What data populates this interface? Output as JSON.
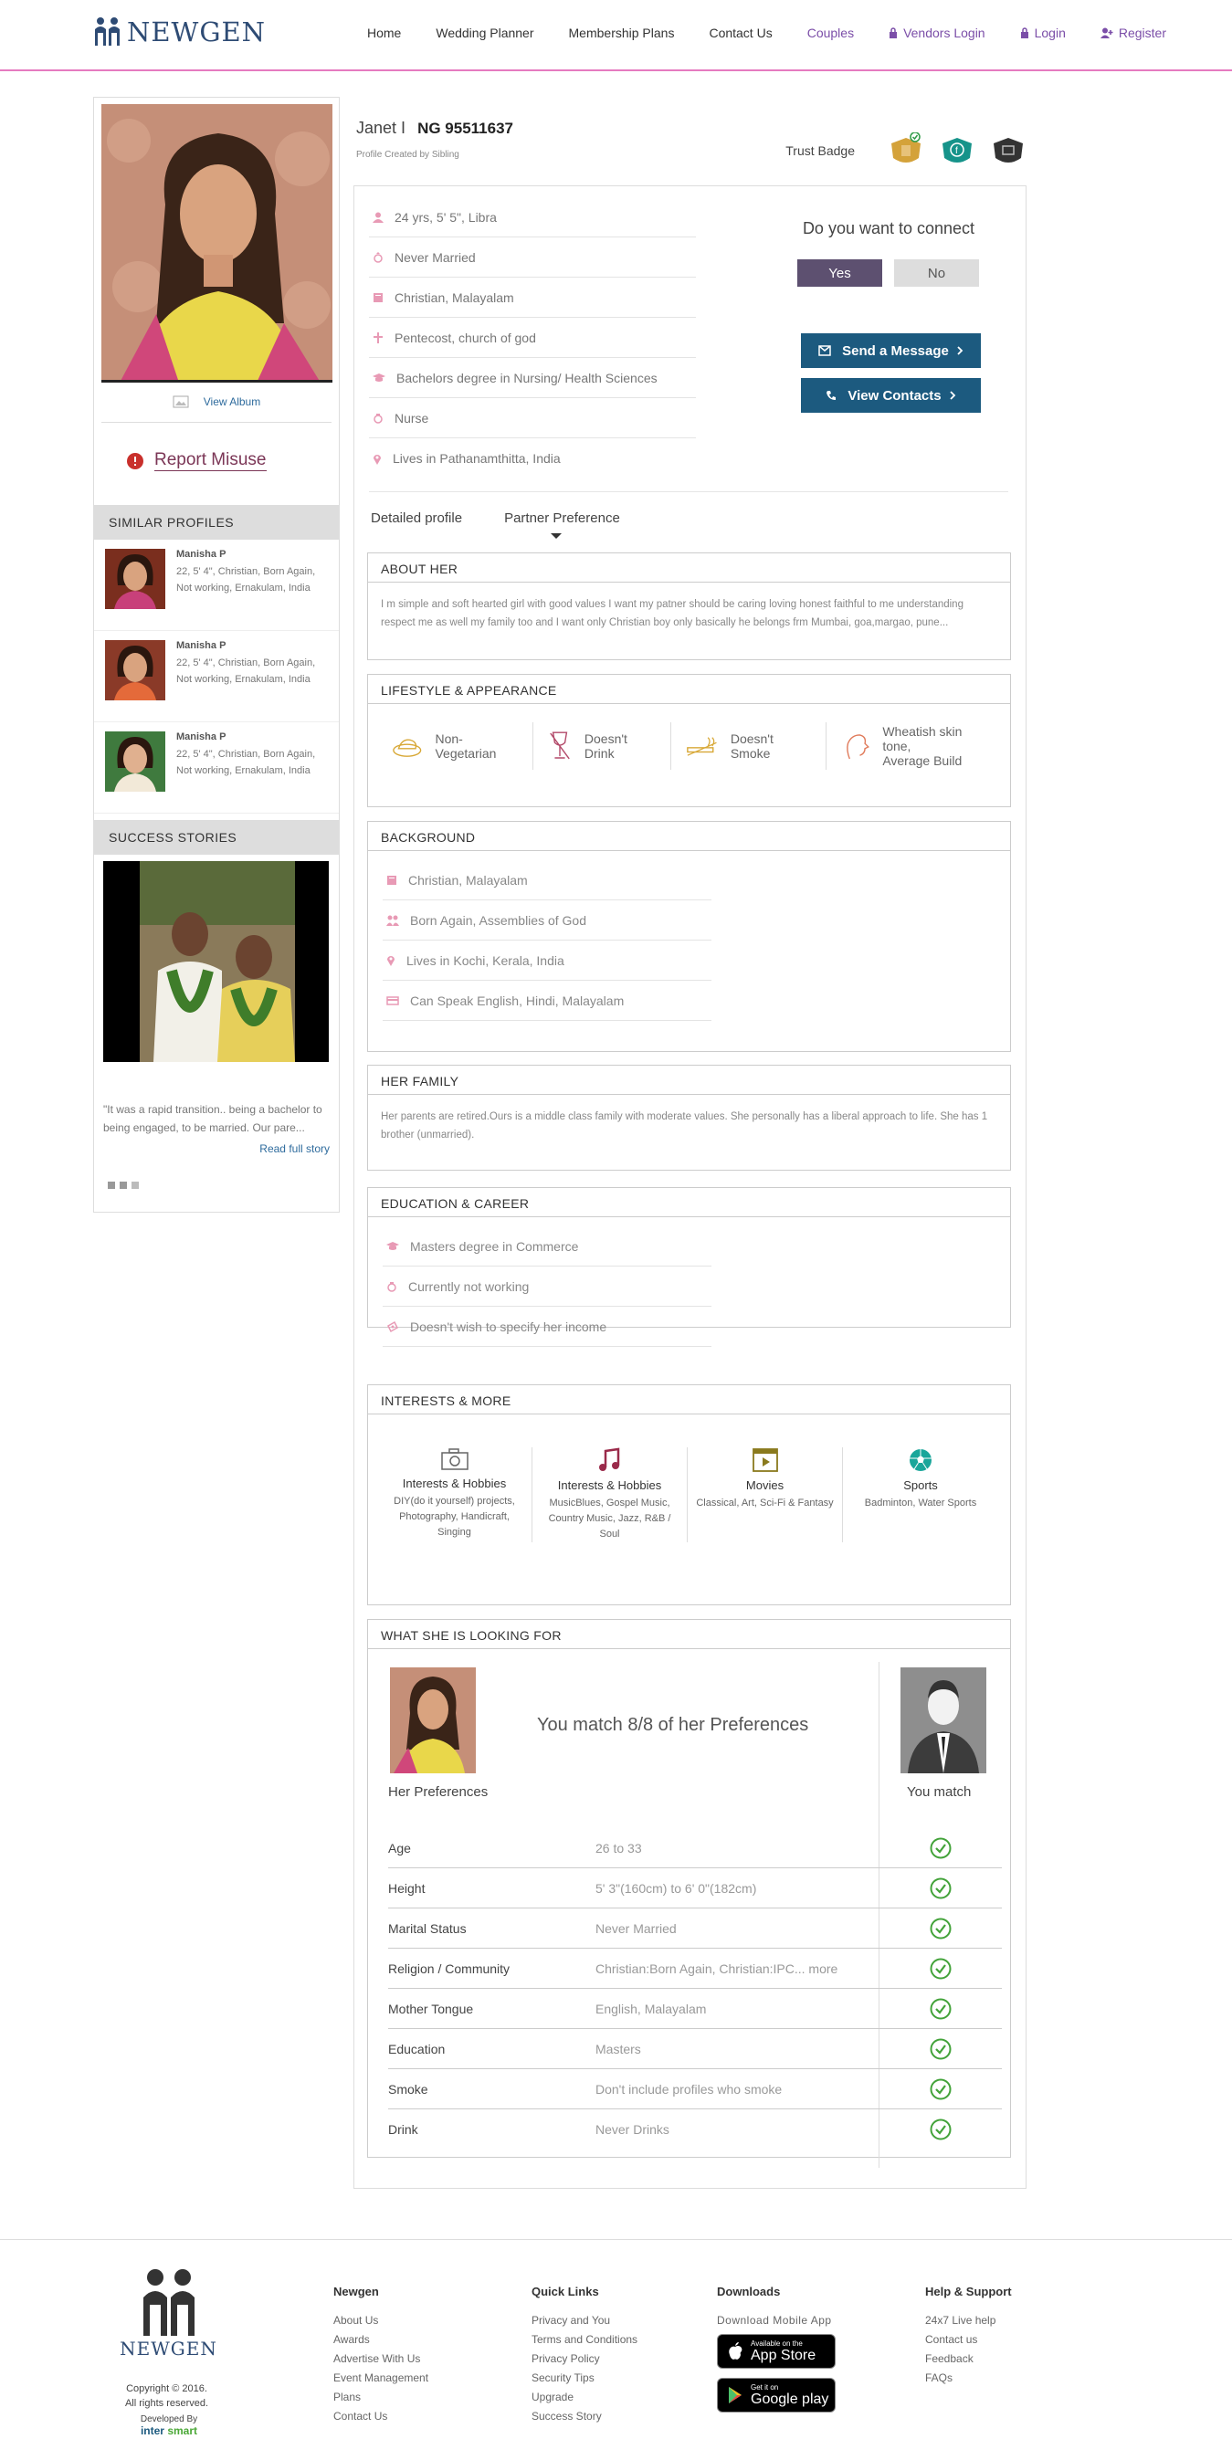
{
  "header": {
    "logo_text": "NEWGEN",
    "nav": [
      {
        "label": "Home"
      },
      {
        "label": "Wedding Planner"
      },
      {
        "label": "Membership Plans"
      },
      {
        "label": "Contact Us"
      },
      {
        "label": "Couples"
      },
      {
        "label": "Vendors Login",
        "icon": "lock-icon"
      },
      {
        "label": "Login",
        "icon": "lock-icon"
      },
      {
        "label": "Register",
        "icon": "add-user-icon"
      }
    ],
    "colors": {
      "brand": "#2e4b74",
      "accent_line": "#e67bc0",
      "link_purple": "#7b4ea8"
    }
  },
  "sidebar": {
    "view_album": "View Album",
    "report_misuse": "Report Misuse",
    "similar_title": "SIMILAR PROFILES",
    "similar": [
      {
        "name": "Manisha P",
        "desc": "22, 5' 4\", Christian, Born Again, Not working, Ernakulam, India"
      },
      {
        "name": "Manisha P",
        "desc": "22, 5' 4\", Christian, Born Again, Not working, Ernakulam, India"
      },
      {
        "name": "Manisha P",
        "desc": "22, 5' 4\", Christian, Born Again, Not working, Ernakulam, India"
      }
    ],
    "success_title": "SUCCESS STORIES",
    "story_text": "\"It was a rapid transition.. being a bachelor to being engaged, to be married. Our pare...",
    "read_full": "Read full story"
  },
  "profile": {
    "name": "Janet I",
    "id": "NG 95511637",
    "created_by": "Profile Created by Sibling",
    "trust_label": "Trust Badge",
    "basic": [
      {
        "icon": "person-icon",
        "text": "24 yrs, 5' 5\", Libra"
      },
      {
        "icon": "ring-icon",
        "text": "Never Married"
      },
      {
        "icon": "book-icon",
        "text": "Christian, Malayalam"
      },
      {
        "icon": "cross-icon",
        "text": "Pentecost, church of god"
      },
      {
        "icon": "graduation-cap-icon",
        "text": "Bachelors degree in Nursing/ Health Sciences"
      },
      {
        "icon": "briefcase-icon",
        "text": "Nurse"
      },
      {
        "icon": "location-pin-icon",
        "text": "Lives in Pathanamthitta, India"
      }
    ],
    "connect_question": "Do you want to connect",
    "yes": "Yes",
    "no": "No",
    "send_message": "Send a Message",
    "view_contacts": "View Contacts",
    "tabs": [
      "Detailed profile",
      "Partner Preference"
    ]
  },
  "sections": {
    "about": {
      "title": "ABOUT HER",
      "text": "I m simple and soft hearted girl with good values I want my patner should be caring loving honest faithful to me understanding respect me as well my family too and I want only Christian boy only basically he belongs frm Mumbai, goa,margao, pune..."
    },
    "lifestyle": {
      "title": "LIFESTYLE & APPEARANCE",
      "items": [
        {
          "icon": "food-plate-icon",
          "text": "Non-Vegetarian"
        },
        {
          "icon": "wine-glass-icon",
          "text": "Doesn't Drink"
        },
        {
          "icon": "cigarette-icon",
          "text": "Doesn't Smoke"
        },
        {
          "icon": "face-profile-icon",
          "text": "Wheatish skin tone,",
          "text2": "Average Build"
        }
      ]
    },
    "background": {
      "title": "BACKGROUND",
      "items": [
        {
          "icon": "book-icon",
          "text": "Christian, Malayalam"
        },
        {
          "icon": "people-icon",
          "text": "Born Again, Assemblies of God"
        },
        {
          "icon": "location-pin-icon",
          "text": "Lives in Kochi, Kerala, India"
        },
        {
          "icon": "language-icon",
          "text": "Can Speak English, Hindi, Malayalam"
        }
      ]
    },
    "family": {
      "title": "HER FAMILY",
      "text": "Her parents are retired.Ours is a middle class family with moderate values. She personally has a liberal approach to life. She has 1 brother (unmarried)."
    },
    "education": {
      "title": "EDUCATION & CAREER",
      "items": [
        {
          "icon": "graduation-cap-icon",
          "text": "Masters degree in Commerce"
        },
        {
          "icon": "briefcase-icon",
          "text": "Currently not working"
        },
        {
          "icon": "money-icon",
          "text": "Doesn't wish to specify her income"
        }
      ]
    },
    "interests": {
      "title": "INTERESTS & MORE",
      "items": [
        {
          "icon": "camera-icon",
          "title": "Interests & Hobbies",
          "text": "DIY(do it yourself) projects, Photography, Handicraft, Singing"
        },
        {
          "icon": "music-note-icon",
          "title": "Interests & Hobbies",
          "text": "MusicBlues, Gospel Music, Country Music, Jazz, R&B / Soul"
        },
        {
          "icon": "movie-icon",
          "title": "Movies",
          "text": "Classical, Art, Sci-Fi & Fantasy"
        },
        {
          "icon": "football-icon",
          "title": "Sports",
          "text": "Badminton, Water Sports"
        }
      ]
    },
    "looking": {
      "title": "WHAT SHE IS LOOKING FOR",
      "her_label": "Her Preferences",
      "match_text": "You match 8/8 of her Preferences",
      "you_label": "You match",
      "rows": [
        {
          "k": "Age",
          "v": "26 to 33"
        },
        {
          "k": "Height",
          "v": "5' 3\"(160cm) to 6' 0\"(182cm)"
        },
        {
          "k": "Marital Status",
          "v": "Never Married"
        },
        {
          "k": "Religion / Community",
          "v": "Christian:Born Again, Christian:IPC... more"
        },
        {
          "k": "Mother Tongue",
          "v": "English, Malayalam"
        },
        {
          "k": "Education",
          "v": "Masters"
        },
        {
          "k": "Smoke",
          "v": "Don't include profiles who smoke"
        },
        {
          "k": "Drink",
          "v": "Never Drinks"
        }
      ]
    }
  },
  "footer": {
    "logo_text": "NEWGEN",
    "copyright": "Copyright © 2016.",
    "rights": "All rights reserved.",
    "developed_by": "Developed By",
    "dev_name_a": "inter",
    "dev_name_b": " smart",
    "columns": [
      {
        "title": "Newgen",
        "links": [
          "About Us",
          "Awards",
          "Advertise With Us",
          "Event Management",
          "Plans",
          "Contact Us"
        ]
      },
      {
        "title": "Quick Links",
        "links": [
          "Privacy and You",
          "Terms and Conditions",
          "Privacy Policy",
          "Security Tips",
          "Upgrade",
          "Success Story"
        ]
      },
      {
        "title": "Downloads",
        "links": [
          "Download Mobile App"
        ]
      },
      {
        "title": "Help & Support",
        "links": [
          "24x7 Live help",
          "Contact us",
          "Feedback",
          "FAQs"
        ]
      }
    ],
    "appstore_small": "Available on the",
    "appstore_big": "App Store",
    "play_small": "Get it on",
    "play_big": "Google play"
  }
}
